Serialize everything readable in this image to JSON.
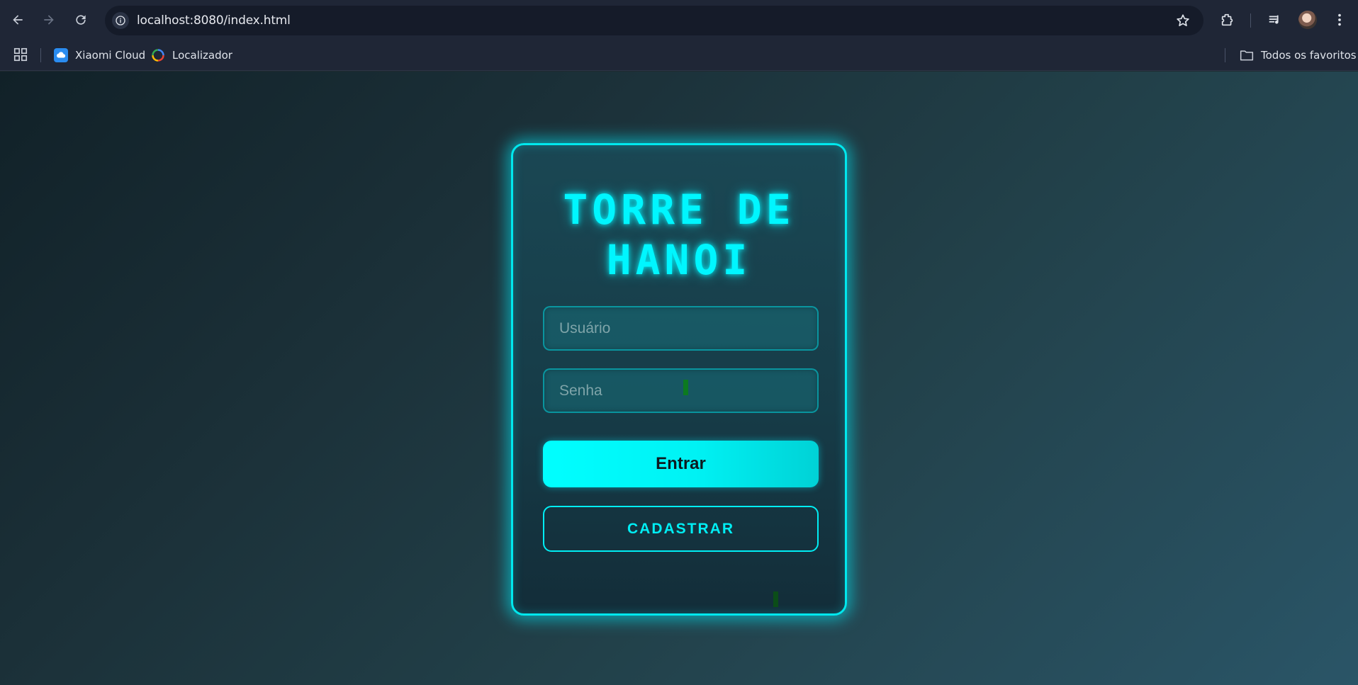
{
  "browser": {
    "url": "localhost:8080/index.html",
    "bookmarks": [
      {
        "label": "Xiaomi Cloud",
        "icon": "cloud-icon"
      },
      {
        "label": "Localizador",
        "icon": "localizador-icon"
      }
    ],
    "all_bookmarks_label": "Todos os favoritos"
  },
  "login": {
    "title_line1": "TORRE DE",
    "title_line2": "HANOI",
    "username_placeholder": "Usuário",
    "password_placeholder": "Senha",
    "login_button": "Entrar",
    "register_button": "CADASTRAR"
  },
  "colors": {
    "accent": "#00f6ff",
    "background_start": "#112128",
    "background_end": "#2a5567"
  }
}
